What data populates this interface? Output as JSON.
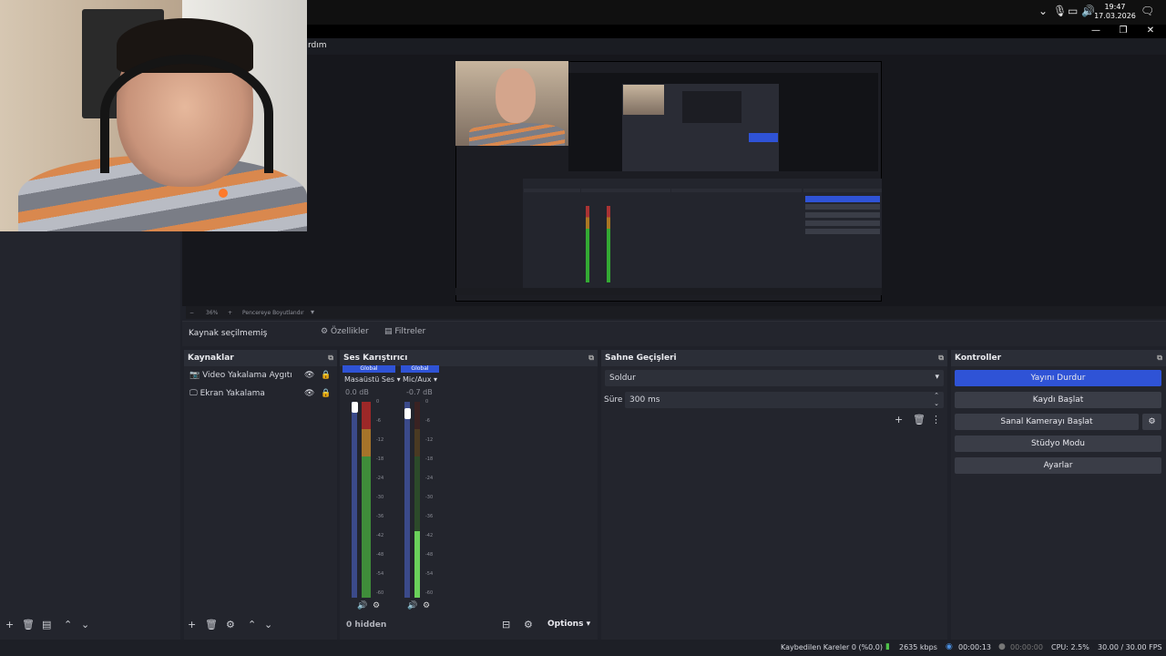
{
  "taskbar": {
    "time": "19:47",
    "date": "17.03.2026"
  },
  "menubar": {
    "partial_text": "rdım"
  },
  "zoom": {
    "minus": "−",
    "value": "36%",
    "plus": "+",
    "mode": "Pencereye Boyutlandır"
  },
  "source_bar": {
    "no_source": "Kaynak seçilmemiş",
    "properties": "Özellikler",
    "filters": "Filtreler"
  },
  "sources": {
    "title": "Kaynaklar",
    "items": [
      {
        "label": "Video Yakalama Aygıtı",
        "icon": "camera-icon"
      },
      {
        "label": "Ekran Yakalama",
        "icon": "monitor-icon"
      }
    ]
  },
  "mixer": {
    "title": "Ses Karıştırıcı",
    "channels": [
      {
        "badge": "Global",
        "name": "Masaüstü Ses",
        "db": "0.0 dB"
      },
      {
        "badge": "Global",
        "name": "Mic/Aux",
        "db": "-0.7 dB"
      }
    ],
    "ticks": [
      "0",
      "-6",
      "-12",
      "-18",
      "-24",
      "-30",
      "-36",
      "-42",
      "-48",
      "-54",
      "-60"
    ],
    "hidden": "0 hidden",
    "options": "Options"
  },
  "transitions": {
    "title": "Sahne Geçişleri",
    "selected": "Soldur",
    "duration_label": "Süre",
    "duration_value": "300 ms"
  },
  "controls": {
    "title": "Kontroller",
    "stop_stream": "Yayını Durdur",
    "start_recording": "Kaydı Başlat",
    "virtual_camera": "Sanal Kamerayı Başlat",
    "studio_mode": "Stüdyo Modu",
    "settings": "Ayarlar",
    "accent": "#2f53d6"
  },
  "status": {
    "dropped_frames": "Kaybedilen Kareler 0 (%0.0)",
    "bitrate": "2635 kbps",
    "stream_time": "00:00:13",
    "rec_time": "00:00:00",
    "cpu": "CPU: 2.5%",
    "fps": "30.00 / 30.00 FPS"
  }
}
